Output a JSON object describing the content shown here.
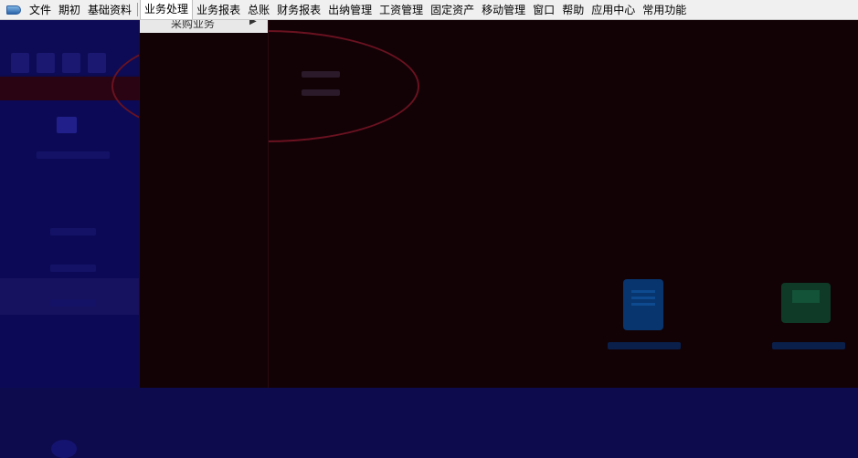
{
  "menubar": {
    "items": [
      "文件",
      "期初",
      "基础资料",
      "业务处理",
      "业务报表",
      "总账",
      "财务报表",
      "出纳管理",
      "工资管理",
      "固定资产",
      "移动管理",
      "窗口",
      "帮助",
      "应用中心",
      "常用功能"
    ]
  },
  "dropdown": {
    "first_item": "采购业务"
  }
}
